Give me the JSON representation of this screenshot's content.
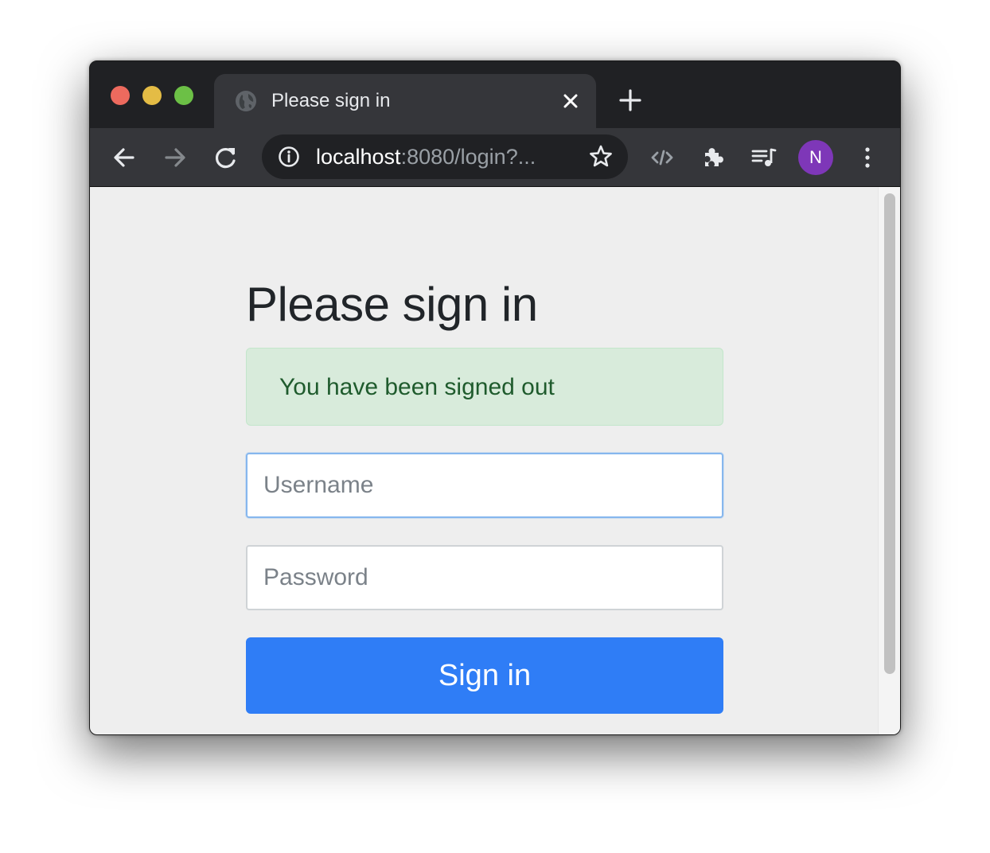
{
  "browser": {
    "tab": {
      "title": "Please sign in",
      "favicon_icon": "globe-icon",
      "close_icon": "close-icon"
    },
    "new_tab_icon": "plus-icon",
    "omnibox": {
      "host": "localhost",
      "rest": ":8080/login?...",
      "info_icon": "info-icon",
      "bookmark_icon": "star-icon"
    },
    "toolbar_icons": [
      "back-arrow-icon",
      "forward-arrow-icon",
      "reload-icon",
      "code-icon",
      "puzzle-icon",
      "media-playlist-icon",
      "more-vert-icon"
    ],
    "profile_initial": "N",
    "colors": {
      "frame": "#202124",
      "toolbar": "#35363a",
      "avatar": "#7e37b8"
    }
  },
  "page": {
    "heading": "Please sign in",
    "alert": "You have been signed out",
    "username": {
      "placeholder": "Username",
      "value": ""
    },
    "password": {
      "placeholder": "Password",
      "value": ""
    },
    "submit_label": "Sign in",
    "colors": {
      "background": "#eeeeee",
      "alert_bg": "#d8ebdb",
      "alert_text": "#1f5b2d",
      "primary": "#2f7df6"
    }
  }
}
